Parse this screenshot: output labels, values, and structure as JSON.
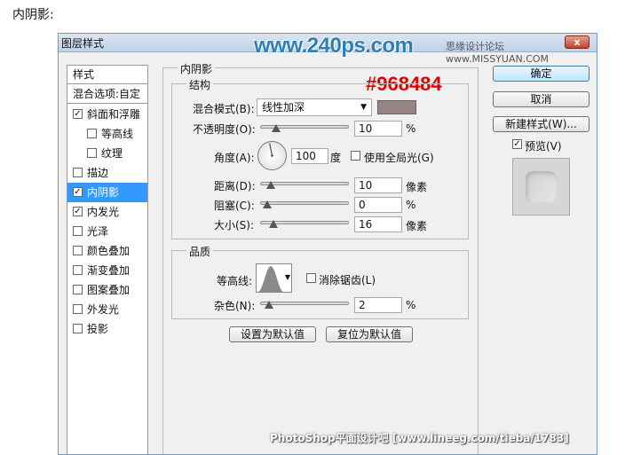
{
  "page": {
    "caption": "内阴影:"
  },
  "dialog": {
    "title": "图层样式",
    "close": "x"
  },
  "watermarks": {
    "site": "www.240ps.com",
    "site2": "思缘设计论坛 www.MISSYUAN.COM",
    "hex": "#968484",
    "footer": "PhotoShop平面设计吧 [www.lineeg.com/tieba/1783]"
  },
  "left_panel": {
    "header1": "样式",
    "header2": "混合选项:自定",
    "items": [
      {
        "label": "斜面和浮雕",
        "checked": true
      },
      {
        "label": "等高线",
        "checked": false
      },
      {
        "label": "纹理",
        "checked": false
      },
      {
        "label": "描边",
        "checked": false
      },
      {
        "label": "内阴影",
        "checked": true,
        "selected": true
      },
      {
        "label": "内发光",
        "checked": true
      },
      {
        "label": "光泽",
        "checked": false
      },
      {
        "label": "颜色叠加",
        "checked": false
      },
      {
        "label": "渐变叠加",
        "checked": false
      },
      {
        "label": "图案叠加",
        "checked": false
      },
      {
        "label": "外发光",
        "checked": false
      },
      {
        "label": "投影",
        "checked": false
      }
    ]
  },
  "inner_shadow": {
    "section_title": "内阴影",
    "structure_title": "结构",
    "blend_mode_label": "混合模式(B):",
    "blend_mode_value": "线性加深",
    "color": "#968484",
    "opacity_label": "不透明度(O):",
    "opacity_value": "10",
    "opacity_level": 0.1,
    "percent": "%",
    "angle_label": "角度(A):",
    "angle_value": "100",
    "angle_unit": "度",
    "global_light_label": "使用全局光(G)",
    "global_light_checked": false,
    "distance_label": "距离(D):",
    "distance_value": "10",
    "distance_unit": "像素",
    "distance_level": 0.04,
    "choke_label": "阻塞(C):",
    "choke_value": "0",
    "choke_level": 0.0,
    "size_label": "大小(S):",
    "size_value": "16",
    "size_unit": "像素",
    "size_level": 0.065,
    "quality_title": "品质",
    "contour_label": "等高线:",
    "antialias_label": "消除锯齿(L)",
    "antialias_checked": false,
    "noise_label": "杂色(N):",
    "noise_value": "2",
    "noise_level": 0.02,
    "set_default_btn": "设置为默认值",
    "reset_default_btn": "复位为默认值"
  },
  "right_panel": {
    "ok_btn": "确定",
    "cancel_btn": "取消",
    "new_style_btn": "新建样式(W)...",
    "preview_label": "预览(V)",
    "preview_checked": true
  }
}
